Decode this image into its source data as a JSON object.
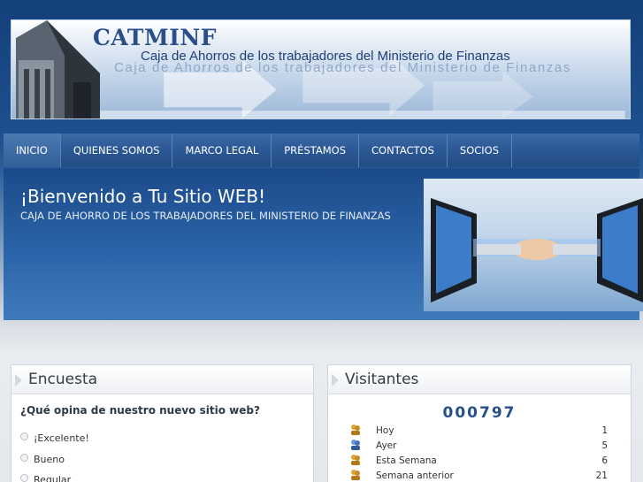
{
  "header": {
    "logo": "CATMINF",
    "tagline": "Caja de Ahorros de los trabajadores del Ministerio de Finanzas",
    "tagline_reflection": "Caja de Ahorros de los trabajadores del Ministerio de Finanzas"
  },
  "nav": {
    "items": [
      {
        "label": "INICIO",
        "active": true
      },
      {
        "label": "QUIENES SOMOS"
      },
      {
        "label": "MARCO LEGAL"
      },
      {
        "label": "PRÉSTAMOS"
      },
      {
        "label": "CONTACTOS"
      },
      {
        "label": "SOCIOS"
      }
    ]
  },
  "hero": {
    "title": "¡Bienvenido a Tu Sitio WEB!",
    "subtitle": "CAJA DE AHORRO DE LOS TRABAJADORES DEL MINISTERIO DE FINANZAS"
  },
  "poll": {
    "title": "Encuesta",
    "question": "¿Qué opina de nuestro nuevo sitio web?",
    "options": [
      "¡Excelente!",
      "Bueno",
      "Regular"
    ]
  },
  "visitors": {
    "title": "Visitantes",
    "counter": "000797",
    "rows": [
      {
        "label": "Hoy",
        "count": "1",
        "icon": "user-group-icon"
      },
      {
        "label": "Ayer",
        "count": "5",
        "icon": "user-group-blue-icon"
      },
      {
        "label": "Esta Semana",
        "count": "6",
        "icon": "user-group-icon"
      },
      {
        "label": "Semana anterior",
        "count": "21",
        "icon": "user-group-icon"
      }
    ]
  },
  "colors": {
    "nav_bg": "#2b5894",
    "hero_bg": "#2b64a8",
    "counter": "#274f88"
  }
}
